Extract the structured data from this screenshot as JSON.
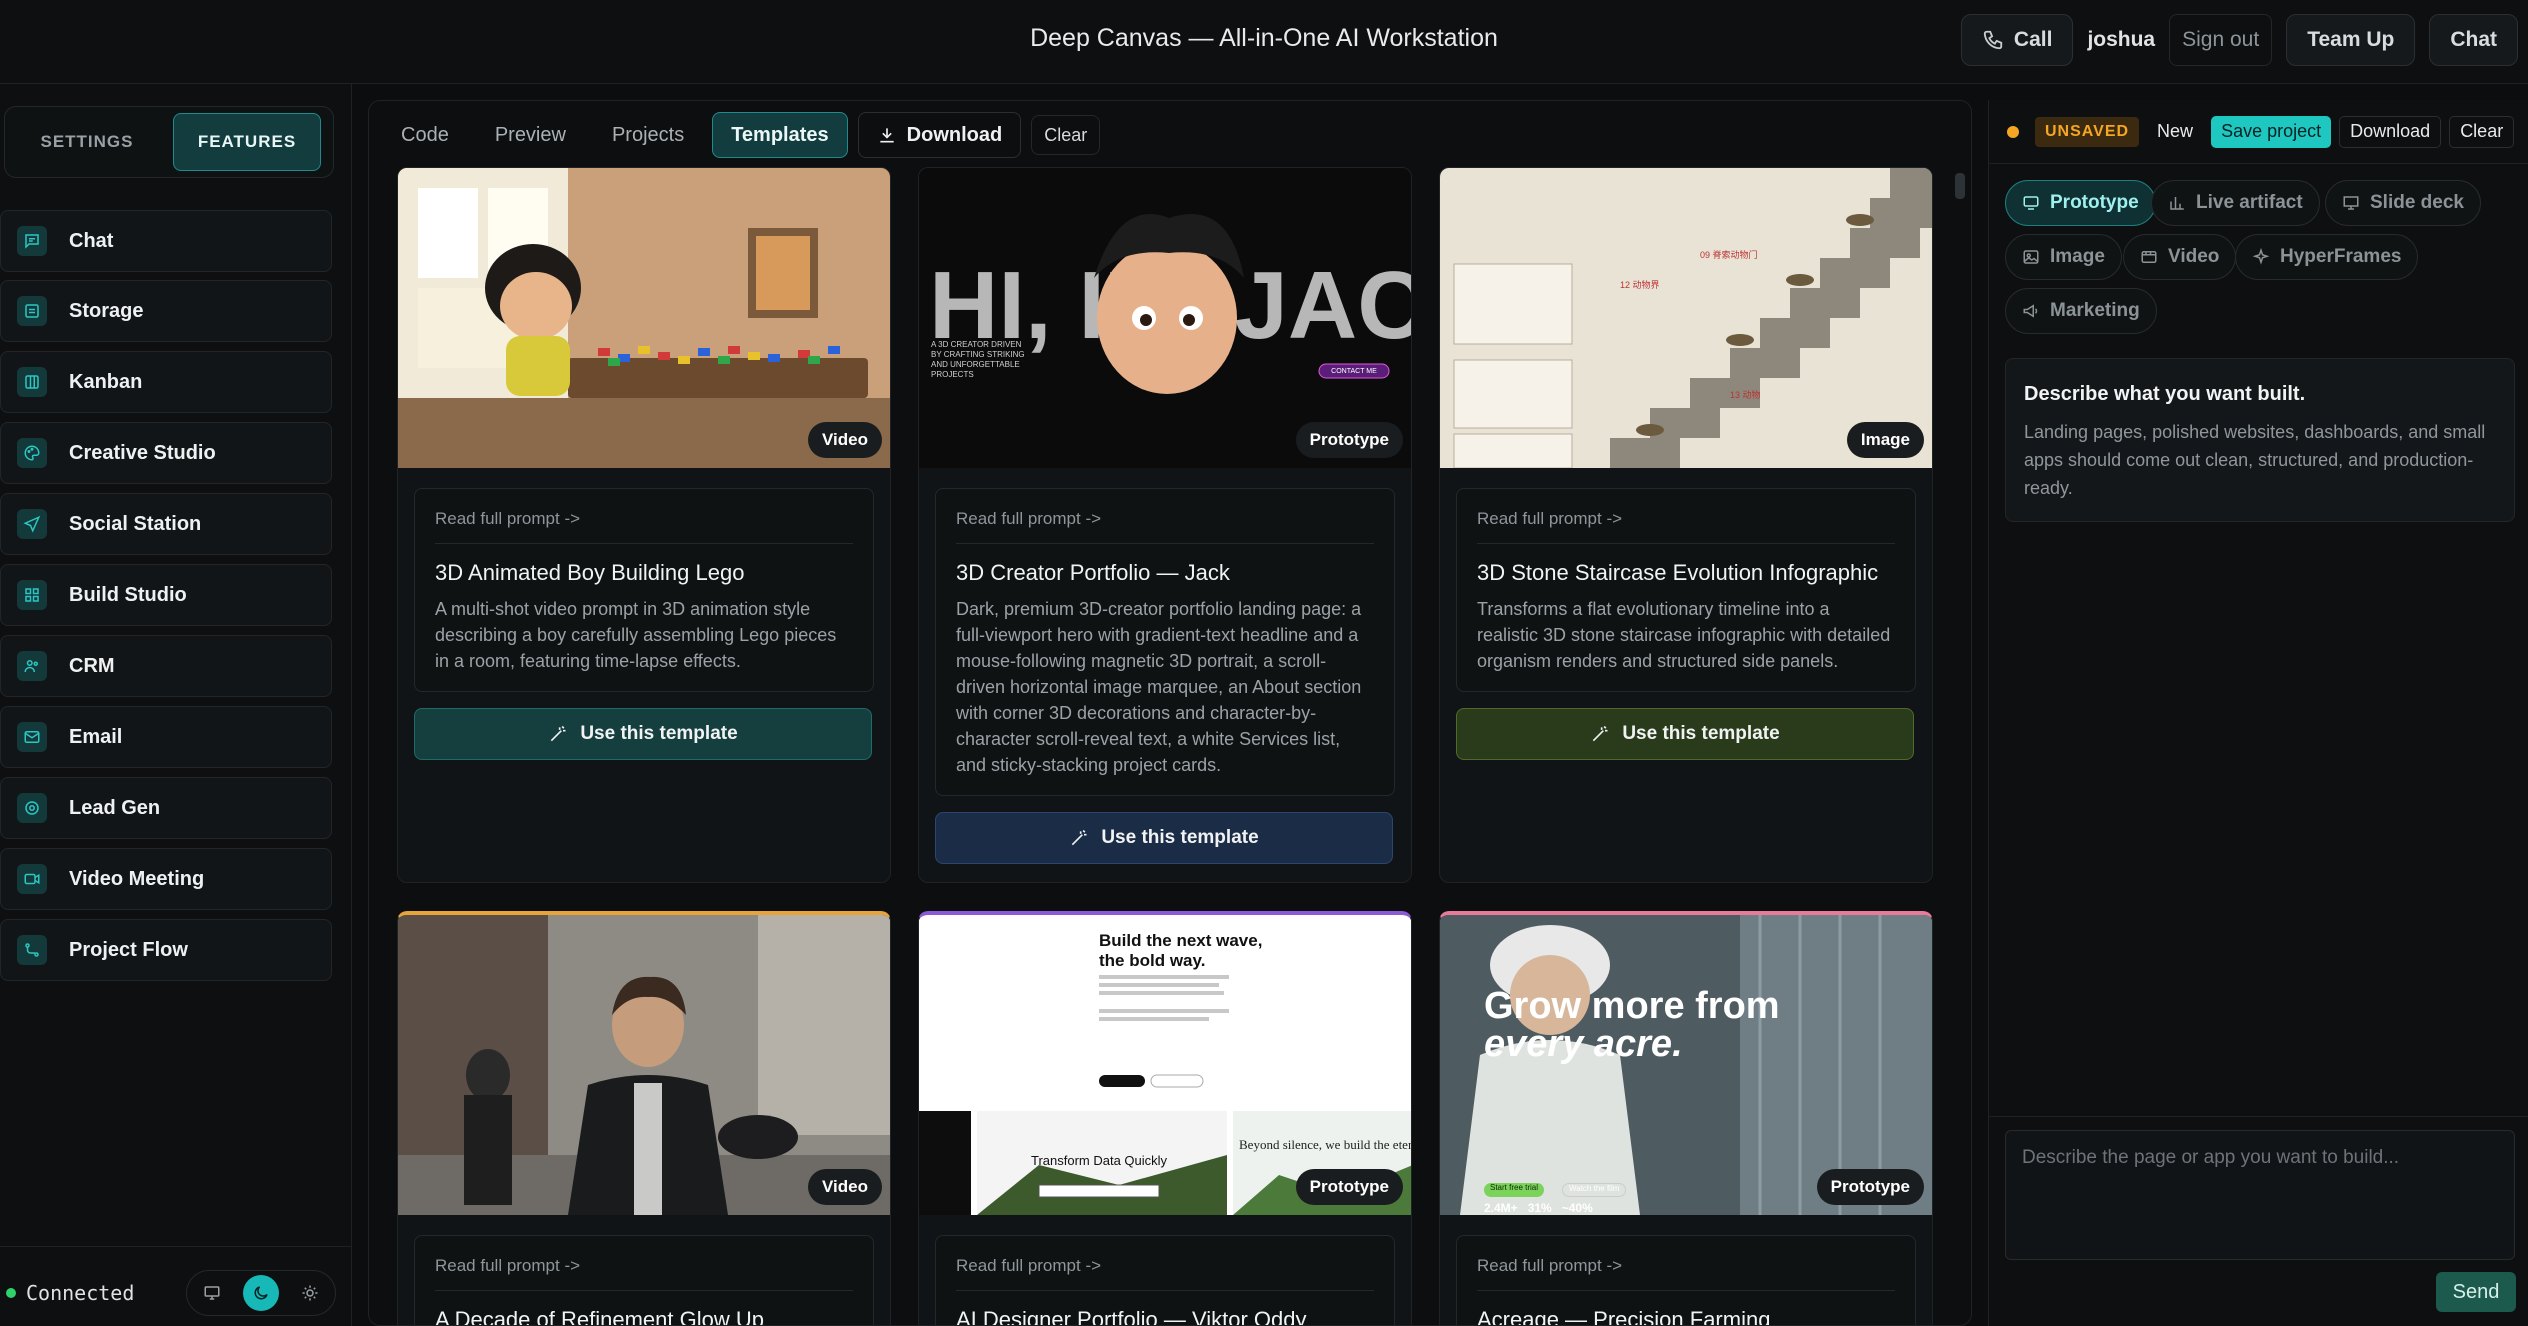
{
  "app_title": "Deep Canvas — All-in-One AI Workstation",
  "top": {
    "call": "Call",
    "user": "joshua",
    "sign_out": "Sign out",
    "team_up": "Team Up",
    "chat": "Chat"
  },
  "left": {
    "tabs": [
      "SETTINGS",
      "FEATURES"
    ],
    "nav": [
      "Chat",
      "Storage",
      "Kanban",
      "Creative Studio",
      "Social Station",
      "Build Studio",
      "CRM",
      "Email",
      "Lead Gen",
      "Video Meeting",
      "Project Flow"
    ],
    "status": "Connected"
  },
  "main": {
    "tabs": [
      "Code",
      "Preview",
      "Projects",
      "Templates"
    ],
    "download": "Download",
    "clear": "Clear",
    "cards": [
      {
        "badge": "Video",
        "read": "Read full prompt ->",
        "title": "3D Animated Boy Building Lego",
        "desc": "A multi-shot video prompt in 3D animation style describing a boy carefully assembling Lego pieces in a room, featuring time-lapse effects.",
        "use": "Use this template"
      },
      {
        "badge": "Prototype",
        "read": "Read full prompt ->",
        "title": "3D Creator Portfolio — Jack",
        "desc": "Dark, premium 3D-creator portfolio landing page: a full-viewport hero with gradient-text headline and a mouse-following magnetic 3D portrait, a scroll-driven horizontal image marquee, an About section with corner 3D decorations and character-by-character scroll-reveal text, a white Services list, and sticky-stacking project cards.",
        "use": "Use this template",
        "thumb_text": "HI, I'M JACK",
        "thumb_small": "A 3D CREATOR DRIVEN BY CRAFTING STRIKING AND UNFORGETTABLE PROJECTS",
        "thumb_btn": "CONTACT ME"
      },
      {
        "badge": "Image",
        "read": "Read full prompt ->",
        "title": "3D Stone Staircase Evolution Infographic",
        "desc": "Transforms a flat evolutionary timeline into a realistic 3D stone staircase infographic with detailed organism renders and structured side panels.",
        "use": "Use this template"
      },
      {
        "badge": "Video",
        "read": "Read full prompt ->",
        "title": "A Decade of Refinement Glow Up"
      },
      {
        "badge": "Prototype",
        "read": "Read full prompt ->",
        "title": "AI Designer Portfolio — Viktor Oddy",
        "thumb_head1": "Build the next wave,",
        "thumb_head2": "the bold way.",
        "thumb_sub": "Transform Data Quickly",
        "thumb_side": "Beyond silence, we build the eter"
      },
      {
        "badge": "Prototype",
        "read": "Read full prompt ->",
        "title": "Acreage — Precision Farming",
        "thumb_head1": "Grow more from",
        "thumb_head2": "every acre.",
        "thumb_btn1": "Start free trial",
        "thumb_btn2": "Watch the film",
        "thumb_stats": "2.4M+   31%   ~40%"
      }
    ]
  },
  "right": {
    "status": "UNSAVED",
    "buttons": {
      "new": "New",
      "save": "Save project",
      "download": "Download",
      "clear": "Clear"
    },
    "modes": [
      "Prototype",
      "Live artifact",
      "Slide deck",
      "Image",
      "Video",
      "HyperFrames",
      "Marketing"
    ],
    "describe_title": "Describe what you want built.",
    "describe_text": "Landing pages, polished websites, dashboards, and small apps should come out clean, structured, and production-ready.",
    "input_placeholder": "Describe the page or app you want to build...",
    "send": "Send"
  }
}
